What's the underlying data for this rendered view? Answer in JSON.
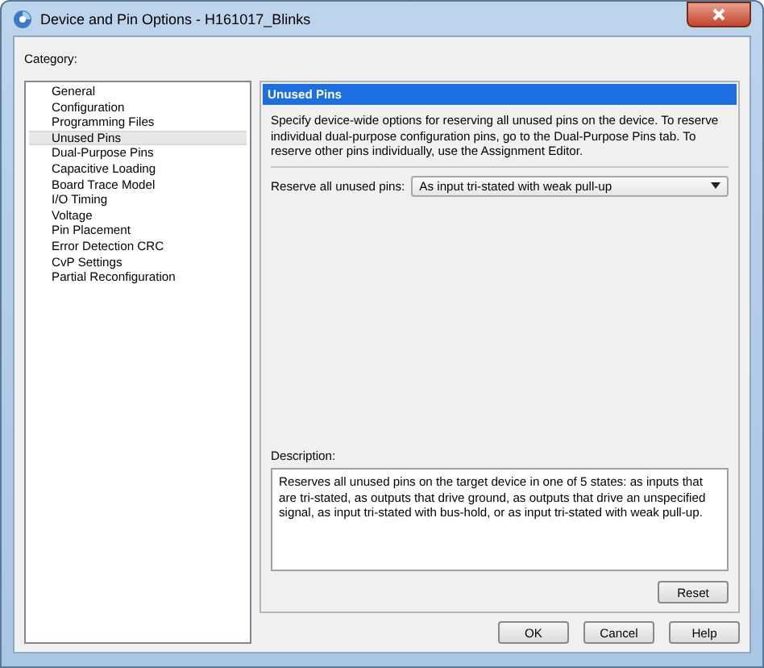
{
  "window": {
    "title": "Device and Pin Options - H161017_Blinks"
  },
  "category_label": "Category:",
  "categories": [
    {
      "label": "General",
      "selected": false
    },
    {
      "label": "Configuration",
      "selected": false
    },
    {
      "label": "Programming Files",
      "selected": false
    },
    {
      "label": "Unused Pins",
      "selected": true
    },
    {
      "label": "Dual-Purpose Pins",
      "selected": false
    },
    {
      "label": "Capacitive Loading",
      "selected": false
    },
    {
      "label": "Board Trace Model",
      "selected": false
    },
    {
      "label": "I/O Timing",
      "selected": false
    },
    {
      "label": "Voltage",
      "selected": false
    },
    {
      "label": "Pin Placement",
      "selected": false
    },
    {
      "label": "Error Detection CRC",
      "selected": false
    },
    {
      "label": "CvP Settings",
      "selected": false
    },
    {
      "label": "Partial Reconfiguration",
      "selected": false
    }
  ],
  "panel": {
    "title": "Unused Pins",
    "intro": "Specify device-wide options for reserving all unused pins on the device. To reserve individual dual-purpose configuration pins, go to the Dual-Purpose Pins tab. To reserve other pins individually, use the Assignment Editor.",
    "reserve_label": "Reserve all unused pins:",
    "reserve_value": "As input tri-stated with weak pull-up",
    "description_label": "Description:",
    "description": "Reserves all unused pins on the target device in one of 5 states: as inputs that are tri-stated, as outputs that drive ground, as outputs that drive an unspecified signal, as input tri-stated with bus-hold, or as input tri-stated with weak pull-up.",
    "reset_button": "Reset"
  },
  "buttons": [
    "OK",
    "Cancel",
    "Help"
  ]
}
